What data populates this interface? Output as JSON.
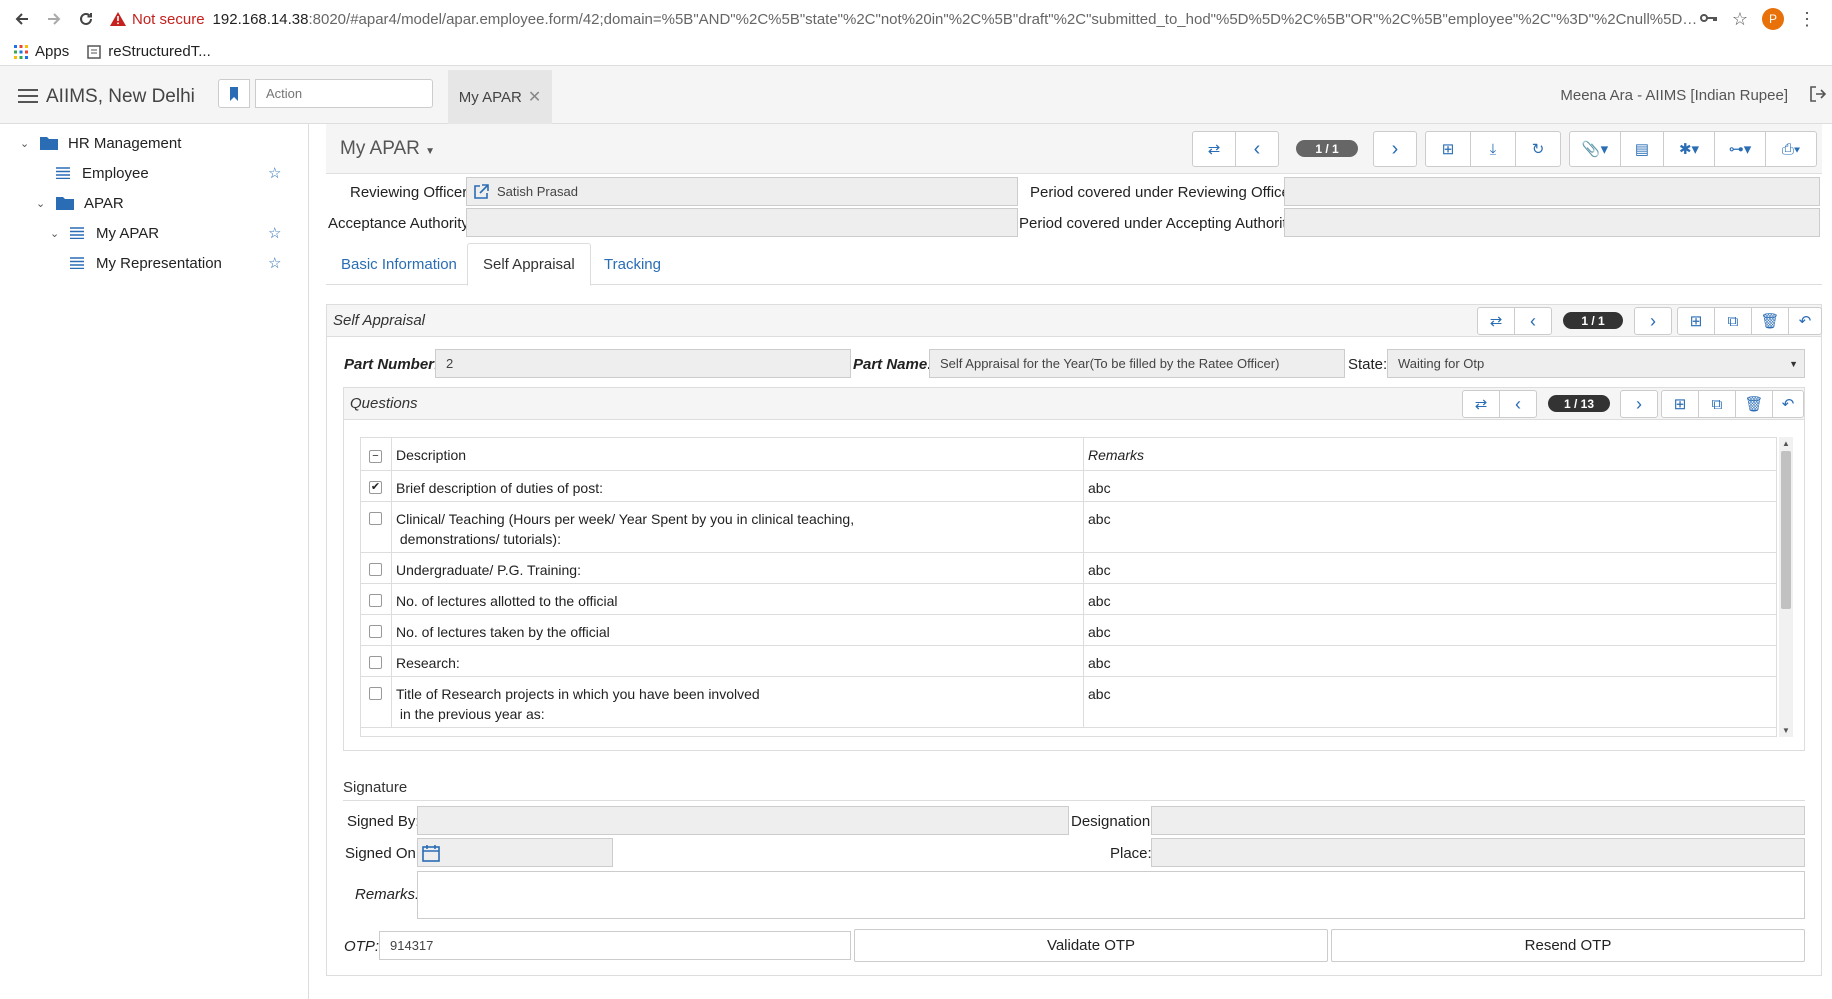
{
  "browser": {
    "warning": "Not secure",
    "url_host": "192.168.14.38",
    "url_rest": ":8020/#apar4/model/apar.employee.form/42;domain=%5B\"AND\"%2C%5B\"state\"%2C\"not%20in\"%2C%5B\"draft\"%2C\"submitted_to_hod\"%5D%5D%2C%5B\"OR\"%2C%5B\"employee\"%2C\"%3D\"%2Cnull%5D%2C%5B...",
    "profile_initial": "P",
    "bookmarks": [
      "Apps",
      "reStructuredT..."
    ]
  },
  "header": {
    "app_title": "AIIMS, New Delhi",
    "action_placeholder": "Action",
    "open_tab": "My APAR",
    "user": "Meena Ara - AIIMS [Indian Rupee]"
  },
  "sidebar": {
    "items": [
      {
        "label": "HR Management"
      },
      {
        "label": "Employee"
      },
      {
        "label": "APAR"
      },
      {
        "label": "My APAR"
      },
      {
        "label": "My Representation"
      }
    ]
  },
  "form": {
    "title": "My APAR",
    "record_counter": "1 / 1",
    "reviewing_officer_label": "Reviewing Officer:",
    "reviewing_officer_value": "Satish Prasad",
    "acceptance_authority_label": "Acceptance Authority:",
    "acceptance_authority_value": "",
    "period_reviewing_label": "Period covered under Reviewing Officer:",
    "period_reviewing_value": "",
    "period_accepting_label": "Period covered under Accepting Authority:",
    "period_accepting_value": "",
    "tabs": [
      {
        "label": "Basic Information"
      },
      {
        "label": "Self Appraisal"
      },
      {
        "label": "Tracking"
      }
    ]
  },
  "self_appraisal": {
    "title": "Self Appraisal",
    "counter": "1 / 1",
    "part_number_label": "Part Number:",
    "part_number_value": "2",
    "part_name_label": "Part Name:",
    "part_name_value": "Self Appraisal for the Year(To be filled by the Ratee Officer)",
    "state_label": "State:",
    "state_value": "Waiting for Otp",
    "questions": {
      "title": "Questions",
      "counter": "1 / 13",
      "col_description": "Description",
      "col_remarks": "Remarks",
      "rows": [
        {
          "line1": "Brief description of duties of post:",
          "line2": "",
          "remarks": "abc",
          "checked": "✔"
        },
        {
          "line1": "Clinical/ Teaching (Hours per week/ Year Spent by you in clinical teaching,",
          "line2": " demonstrations/ tutorials):",
          "remarks": "abc",
          "checked": ""
        },
        {
          "line1": "Undergraduate/ P.G. Training:",
          "line2": "",
          "remarks": "abc",
          "checked": ""
        },
        {
          "line1": "No. of lectures allotted to the official",
          "line2": "",
          "remarks": "abc",
          "checked": ""
        },
        {
          "line1": "No. of lectures taken by the official",
          "line2": "",
          "remarks": "abc",
          "checked": ""
        },
        {
          "line1": "Research:",
          "line2": "",
          "remarks": "abc",
          "checked": ""
        },
        {
          "line1": "Title of Research projects in which you have been involved",
          "line2": " in the previous year as:",
          "remarks": "abc",
          "checked": ""
        }
      ]
    },
    "signature": {
      "title": "Signature",
      "signed_by_label": "Signed By:",
      "signed_by_value": "",
      "designation_label": "Designation:",
      "designation_value": "",
      "signed_on_label": "Signed On:",
      "signed_on_value": "",
      "place_label": "Place:",
      "place_value": "",
      "remarks_label": "Remarks:",
      "remarks_value": ""
    },
    "otp_label": "OTP:",
    "otp_value": "914317",
    "validate_label": "Validate OTP",
    "resend_label": "Resend OTP"
  }
}
